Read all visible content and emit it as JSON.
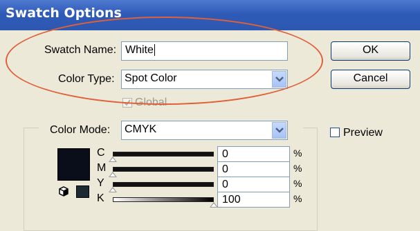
{
  "dialog": {
    "title": "Swatch Options"
  },
  "swatch_name": {
    "label": "Swatch Name:",
    "value": "White"
  },
  "color_type": {
    "label": "Color Type:",
    "value": "Spot Color"
  },
  "global": {
    "label": "Global",
    "checked": true,
    "enabled": false
  },
  "color_mode": {
    "label": "Color Mode:",
    "value": "CMYK"
  },
  "buttons": {
    "ok": "OK",
    "cancel": "Cancel"
  },
  "preview": {
    "label": "Preview",
    "checked": false
  },
  "channels": [
    {
      "letter": "C",
      "value": "0",
      "unit": "%",
      "level": 0
    },
    {
      "letter": "M",
      "value": "0",
      "unit": "%",
      "level": 0
    },
    {
      "letter": "Y",
      "value": "0",
      "unit": "%",
      "level": 0
    },
    {
      "letter": "K",
      "value": "100",
      "unit": "%",
      "level": 100
    }
  ],
  "colors": {
    "swatch_fill": "#0a0e1a",
    "annotation": "#e0603a",
    "title_bar": "#2f5bb8"
  }
}
